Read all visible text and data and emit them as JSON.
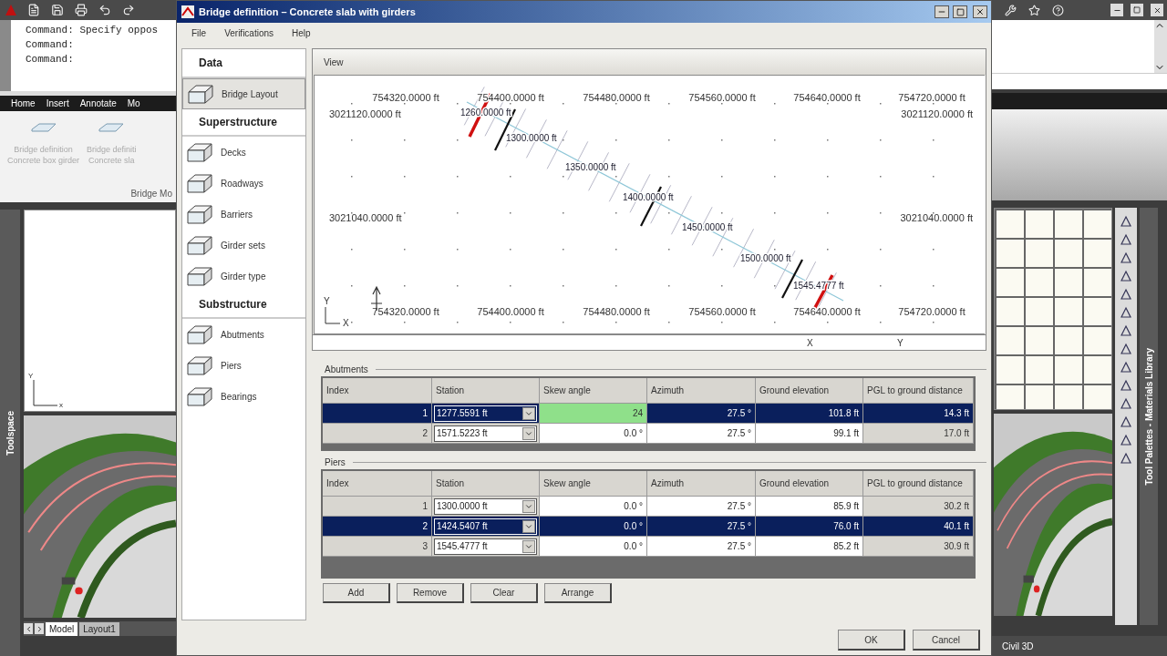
{
  "app": {
    "command_lines": [
      "Command: Specify oppos",
      "Command:",
      "Command:"
    ],
    "ribbon_tabs": [
      "Home",
      "Insert",
      "Annotate",
      "Mo"
    ],
    "ribbon_buttons": [
      {
        "line1": "Bridge definition",
        "line2": "Concrete box girder"
      },
      {
        "line1": "Bridge definiti",
        "line2": "Concrete sla"
      }
    ],
    "ribbon_panel": "Bridge Mo",
    "toolspace": "Toolspace",
    "viewport_ucs": {
      "y": "Y",
      "x": "x"
    },
    "layout_tabs": [
      {
        "label": "Model",
        "selected": true
      },
      {
        "label": "Layout1",
        "selected": false
      }
    ],
    "palette_title": "Tool Palettes - Materials Library",
    "workspace": "Civil 3D"
  },
  "dialog": {
    "title": "Bridge definition – Concrete slab with girders",
    "menu": [
      "File",
      "Verifications",
      "Help"
    ],
    "sidebar": [
      {
        "title": "Data",
        "items": [
          {
            "label": "Bridge Layout",
            "selected": true
          }
        ]
      },
      {
        "title": "Superstructure",
        "items": [
          {
            "label": "Decks",
            "selected": false
          },
          {
            "label": "Roadways",
            "selected": false
          },
          {
            "label": "Barriers",
            "selected": false
          },
          {
            "label": "Girder sets",
            "selected": false
          },
          {
            "label": "Girder type",
            "selected": false
          }
        ]
      },
      {
        "title": "Substructure",
        "items": [
          {
            "label": "Abutments",
            "selected": false
          },
          {
            "label": "Piers",
            "selected": false
          },
          {
            "label": "Bearings",
            "selected": false
          }
        ]
      }
    ],
    "view": {
      "title": "View",
      "top_labels": [
        "754320.0000 ft",
        "754400.0000 ft",
        "754480.0000 ft",
        "754560.0000 ft",
        "754640.0000 ft",
        "754720.0000 ft"
      ],
      "bottom_labels": [
        "754320.0000 ft",
        "754400.0000 ft",
        "754480.0000 ft",
        "754560.0000 ft",
        "754640.0000 ft",
        "754720.0000 ft"
      ],
      "left_labels": [
        "3021120.0000 ft",
        "3021040.0000 ft"
      ],
      "right_labels": [
        "3021120.0000 ft",
        "3021040.0000 ft"
      ],
      "stations": [
        "1260.0000 ft",
        "1300.0000 ft",
        "1350.0000 ft",
        "1400.0000 ft",
        "1450.0000 ft",
        "1500.0000 ft",
        "1545.4777 ft"
      ],
      "ucs": {
        "y": "Y",
        "x": "X"
      },
      "status": [
        "X",
        "Y"
      ]
    },
    "abutments": {
      "title": "Abutments",
      "columns": [
        "Index",
        "Station",
        "Skew angle",
        "Azimuth",
        "Ground elevation",
        "PGL to ground distance"
      ],
      "rows": [
        {
          "selected": true,
          "skew_editing": true,
          "index": "1",
          "station": "1277.5591 ft",
          "skew_angle": "24",
          "azimuth": "27.5 °",
          "ground_elevation": "101.8 ft",
          "pgl_distance": "14.3 ft"
        },
        {
          "selected": false,
          "skew_editing": false,
          "index": "2",
          "station": "1571.5223 ft",
          "skew_angle": "0.0 °",
          "azimuth": "27.5 °",
          "ground_elevation": "99.1 ft",
          "pgl_distance": "17.0 ft"
        }
      ]
    },
    "piers": {
      "title": "Piers",
      "columns": [
        "Index",
        "Station",
        "Skew angle",
        "Azimuth",
        "Ground elevation",
        "PGL to ground distance"
      ],
      "rows": [
        {
          "selected": false,
          "skew_editing": false,
          "index": "1",
          "station": "1300.0000 ft",
          "skew_angle": "0.0 °",
          "azimuth": "27.5 °",
          "ground_elevation": "85.9 ft",
          "pgl_distance": "30.2 ft"
        },
        {
          "selected": true,
          "skew_editing": false,
          "index": "2",
          "station": "1424.5407 ft",
          "skew_angle": "0.0 °",
          "azimuth": "27.5 °",
          "ground_elevation": "76.0 ft",
          "pgl_distance": "40.1 ft"
        },
        {
          "selected": false,
          "skew_editing": false,
          "index": "3",
          "station": "1545.4777 ft",
          "skew_angle": "0.0 °",
          "azimuth": "27.5 °",
          "ground_elevation": "85.2 ft",
          "pgl_distance": "30.9 ft"
        }
      ]
    },
    "table_buttons": [
      "Add",
      "Remove",
      "Clear",
      "Arrange"
    ],
    "buttons": [
      "OK",
      "Cancel"
    ]
  }
}
